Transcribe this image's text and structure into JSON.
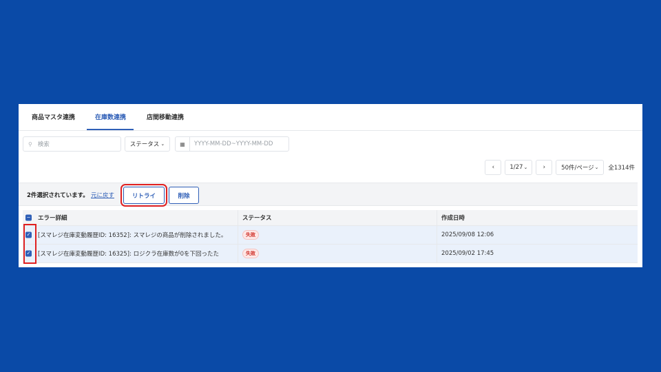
{
  "tabs": [
    {
      "label": "商品マスタ連携"
    },
    {
      "label": "在庫数連携"
    },
    {
      "label": "店間移動連携"
    }
  ],
  "filters": {
    "search_placeholder": "検索",
    "status_label": "ステータス",
    "date_placeholder": "YYYY-MM-DD~YYYY-MM-DD",
    "search_icon": "search-icon",
    "calendar_icon": "calendar-icon"
  },
  "pagination": {
    "page": "1/27",
    "per_page": "50件/ページ",
    "total": "全1314件"
  },
  "bulk": {
    "selected_text": "2件選択されています。",
    "undo_label": "元に戻す",
    "retry_label": "リトライ",
    "delete_label": "削除"
  },
  "table": {
    "headers": {
      "detail": "エラー詳細",
      "status": "ステータス",
      "created": "作成日時"
    },
    "rows": [
      {
        "detail": "[スマレジ在庫変動履歴ID: 16352]: スマレジの商品が削除されました。",
        "status": "失敗",
        "created": "2025/09/08 12:06",
        "checked": true
      },
      {
        "detail": "[スマレジ在庫変動履歴ID: 16325]: ロジクラ在庫数が0を下回ったた",
        "status": "失敗",
        "created": "2025/09/02 17:45",
        "checked": true
      }
    ]
  },
  "colors": {
    "accent": "#2f5fb7",
    "background": "#0a4aa7",
    "highlight": "#e02020",
    "fail": "#d0342c"
  }
}
